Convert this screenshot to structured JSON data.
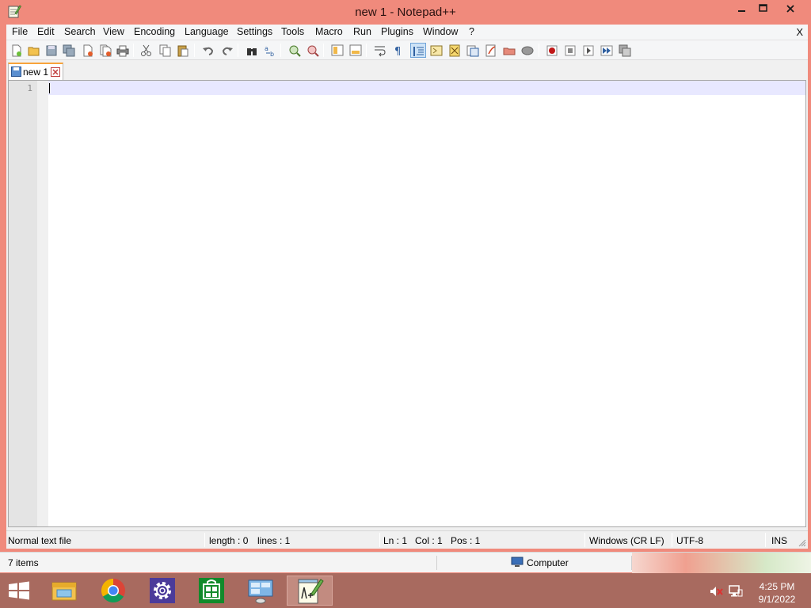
{
  "window": {
    "title": "new 1 - Notepad++",
    "close_glyph": "✕",
    "maximize_glyph": "□",
    "minimize_glyph": "—"
  },
  "menu": {
    "items": [
      "File",
      "Edit",
      "Search",
      "View",
      "Encoding",
      "Language",
      "Settings",
      "Tools",
      "Macro",
      "Run",
      "Plugins",
      "Window",
      "?"
    ],
    "close_doc": "X"
  },
  "toolbar": {
    "icons": [
      "new-file",
      "open-file",
      "save",
      "save-all",
      "close",
      "close-all",
      "print",
      "cut",
      "copy",
      "paste",
      "undo",
      "redo",
      "find",
      "replace",
      "zoom-in",
      "zoom-out",
      "sync-vertical",
      "sync-horizontal",
      "word-wrap",
      "show-all-characters",
      "indent-guide",
      "user-defined-language",
      "document-map",
      "function-list",
      "folder-as-workspace",
      "monitoring",
      "record-macro",
      "stop-macro",
      "play-macro",
      "run-macro-multiple",
      "save-macro"
    ],
    "active": "indent-guide"
  },
  "tabs": [
    {
      "label": "new 1",
      "active": true
    }
  ],
  "editor": {
    "line_numbers": [
      "1"
    ],
    "content": ""
  },
  "status": {
    "file_type": "Normal text file",
    "length": "length : 0",
    "lines": "lines : 1",
    "ln": "Ln : 1",
    "col": "Col : 1",
    "pos": "Pos : 1",
    "eol": "Windows (CR LF)",
    "encoding": "UTF-8",
    "mode": "INS"
  },
  "explorer": {
    "items": "7 items",
    "location": "Computer"
  },
  "taskbar": {
    "apps": [
      {
        "name": "file-explorer",
        "active": false
      },
      {
        "name": "chrome",
        "active": false
      },
      {
        "name": "settings",
        "active": false
      },
      {
        "name": "store",
        "active": false
      },
      {
        "name": "remote-desktop",
        "active": false
      },
      {
        "name": "notepad-plus-plus",
        "active": true
      }
    ],
    "time": "4:25 PM",
    "date": "9/1/2022"
  },
  "colors": {
    "window_frame": "#f08a7c",
    "taskbar": "#a86a5f",
    "current_line": "#e8e8ff",
    "tab_accent": "#f8a33b"
  }
}
